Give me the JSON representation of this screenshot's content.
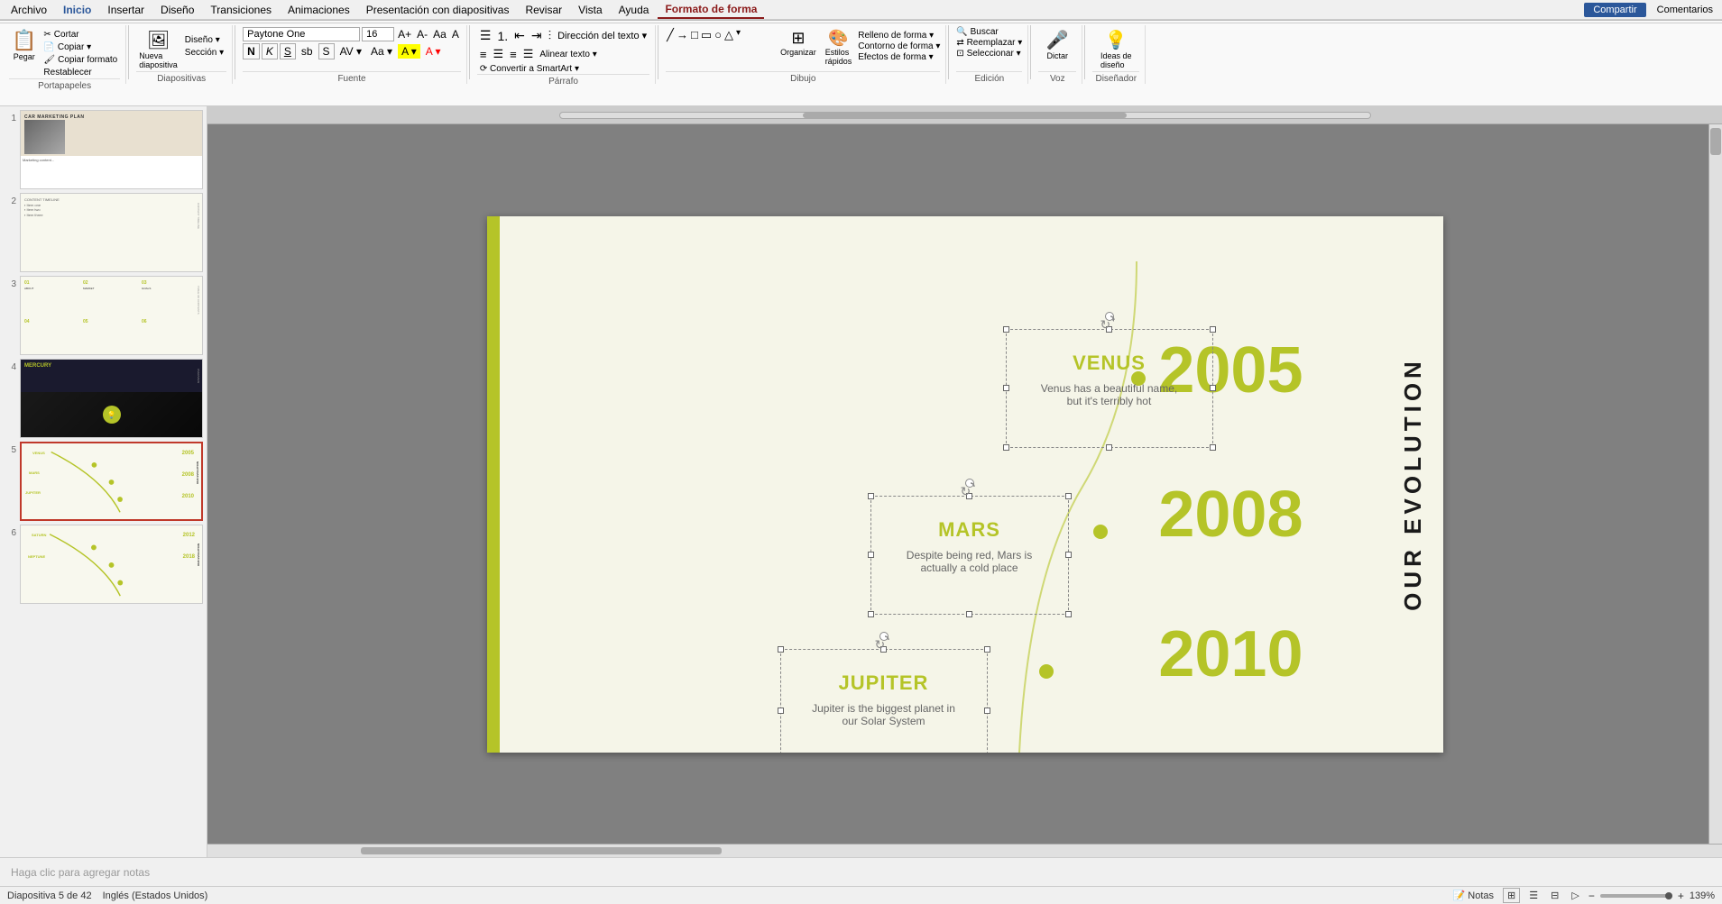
{
  "menu": {
    "items": [
      "Archivo",
      "Inicio",
      "Insertar",
      "Diseño",
      "Transiciones",
      "Animaciones",
      "Presentación con diapositivas",
      "Revisar",
      "Vista",
      "Ayuda"
    ],
    "active": "Inicio",
    "format_shape": "Formato de forma"
  },
  "topRight": {
    "share": "Compartir",
    "comments": "Comentarios"
  },
  "ribbon": {
    "portapapeles": {
      "label": "Portapapeles",
      "buttons": [
        "Pegar",
        "Cortar",
        "Copiar",
        "Copiar formato",
        "Restablecer"
      ]
    },
    "diapositivas": {
      "label": "Diapositivas",
      "buttons": [
        "Nueva diapositiva",
        "Diseño",
        "Sección"
      ]
    },
    "fuente": {
      "label": "Fuente",
      "font": "Paytone One",
      "size": "16",
      "buttons": [
        "A+",
        "A-",
        "Aa",
        "N",
        "K",
        "S",
        "sb",
        "S",
        "A",
        "A"
      ]
    },
    "parrafo": {
      "label": "Párrafo",
      "buttons": [
        "lista",
        "lista-num",
        "sangria-dec",
        "sangria-inc",
        "cols",
        "alinear-izq",
        "centrar",
        "alinear-der",
        "justificar",
        "texto-dir",
        "alinear-texto",
        "convertir-smartart"
      ]
    },
    "dibujo": {
      "label": "Dibujo",
      "fill": "Relleno de forma",
      "outline": "Contorno de forma",
      "effects": "Efectos de forma",
      "organize": "Organizar",
      "styles": "Estilos rápidos"
    },
    "edicion": {
      "label": "Edición",
      "buttons": [
        "Buscar",
        "Reemplazar",
        "Seleccionar"
      ]
    },
    "voz": {
      "label": "Voz",
      "buttons": [
        "Dictar"
      ]
    },
    "disenador": {
      "label": "Diseñador",
      "buttons": [
        "Ideas de diseño"
      ]
    }
  },
  "slides": [
    {
      "num": 1,
      "type": "car-marketing",
      "label": "CAR MARKETING PLAN",
      "active": false
    },
    {
      "num": 2,
      "type": "text",
      "label": "Slide 2",
      "active": false
    },
    {
      "num": 3,
      "type": "grid",
      "label": "01 02 03",
      "active": false
    },
    {
      "num": 4,
      "type": "mercury",
      "label": "MERCURY",
      "active": false
    },
    {
      "num": 5,
      "type": "timeline",
      "label": "Timeline slide",
      "active": true
    },
    {
      "num": 6,
      "type": "timeline2",
      "label": "Timeline slide 2",
      "active": false
    }
  ],
  "slide5": {
    "title": "OUR EVOLUTION",
    "years": [
      "2005",
      "2008",
      "2010"
    ],
    "planets": [
      {
        "name": "VENUS",
        "desc_line1": "Venus has a beautiful name,",
        "desc_line2": "but it's terribly hot"
      },
      {
        "name": "MARS",
        "desc_line1": "Despite being red, Mars is",
        "desc_line2": "actually a cold place"
      },
      {
        "name": "JUPITER",
        "desc_line1": "Jupiter is the biggest planet in",
        "desc_line2": "our Solar System"
      }
    ]
  },
  "notes": {
    "placeholder": "Haga clic para agregar notas"
  },
  "status": {
    "slide_info": "Diapositiva 5 de 42",
    "language": "Inglés (Estados Unidos)",
    "views": [
      "normal",
      "outline",
      "slide-sorter",
      "reading"
    ],
    "zoom": "139%"
  }
}
